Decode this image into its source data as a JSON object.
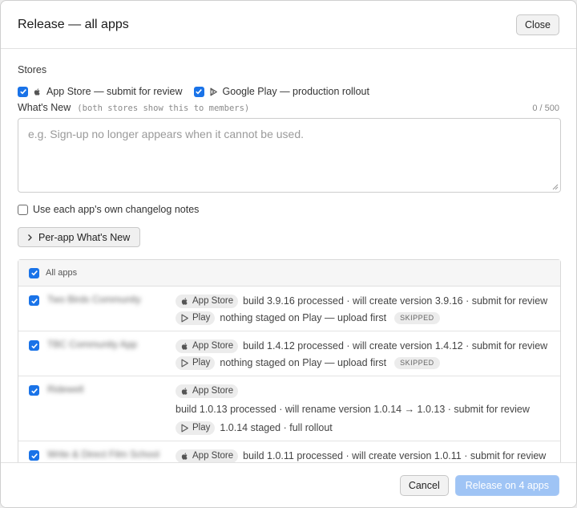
{
  "dialog": {
    "title": "Release — all apps",
    "close_label": "Close"
  },
  "stores": {
    "label": "Stores",
    "options": [
      {
        "label": "App Store — submit for review",
        "checked": true,
        "icon": "apple-icon"
      },
      {
        "label": "Google Play — production rollout",
        "checked": true,
        "icon": "play-icon"
      }
    ]
  },
  "whats_new": {
    "label": "What's New",
    "hint": "(both stores show this to members)",
    "count": "0 / 500",
    "placeholder": "e.g. Sign-up no longer appears when it cannot be used."
  },
  "own_notes": {
    "label": "Use each app's own changelog notes",
    "checked": false
  },
  "per_app_button": {
    "label": "Per-app What's New",
    "icon": "chevron-right-icon"
  },
  "apps": {
    "all_label": "All apps",
    "rows": [
      {
        "name": "Two Birds Community",
        "lines": [
          {
            "store": "App Store",
            "icon": "apple-icon",
            "text": "build 3.9.16 processed · will create version 3.9.16 · submit for review"
          },
          {
            "store": "Play",
            "icon": "play-icon",
            "text": "nothing staged on Play — upload first",
            "badge": "SKIPPED"
          }
        ]
      },
      {
        "name": "TBC Community App",
        "lines": [
          {
            "store": "App Store",
            "icon": "apple-icon",
            "text": "build 1.4.12 processed · will create version 1.4.12 · submit for review"
          },
          {
            "store": "Play",
            "icon": "play-icon",
            "text": "nothing staged on Play — upload first",
            "badge": "SKIPPED"
          }
        ]
      },
      {
        "name": "Ridewell",
        "lines": [
          {
            "store": "App Store",
            "icon": "apple-icon",
            "text": ""
          },
          {
            "store": "",
            "icon": "",
            "text": "build 1.0.13 processed · will rename version 1.0.14 → 1.0.13 · submit for review"
          },
          {
            "store": "Play",
            "icon": "play-icon",
            "text": "1.0.14 staged · full rollout"
          }
        ]
      },
      {
        "name": "Write & Direct Film School",
        "lines": [
          {
            "store": "App Store",
            "icon": "apple-icon",
            "text": "build 1.0.11 processed · will create version 1.0.11 · submit for review"
          }
        ]
      }
    ]
  },
  "footer": {
    "cancel_label": "Cancel",
    "release_label": "Release on 4 apps"
  },
  "colors": {
    "accent": "#1a73e8",
    "release_disabled": "#9fc4f5"
  }
}
